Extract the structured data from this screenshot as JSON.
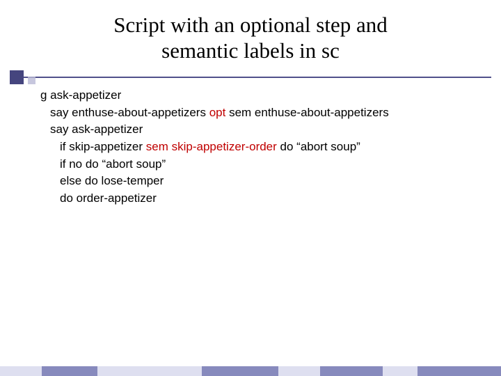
{
  "title_line1": "Script with an optional step and",
  "title_line2": "semantic labels in sc",
  "lines": {
    "l1": "g ask-appetizer",
    "l2a": "say enthuse-about-appetizers ",
    "l2b": "opt",
    "l2c": " sem enthuse-about-appetizers",
    "l3": "say ask-appetizer",
    "l4a": "if skip-appetizer ",
    "l4b": "sem skip-appetizer-order",
    "l4c": " do “abort soup”",
    "l5": "if no do “abort soup”",
    "l6": "else do lose-temper",
    "l7": "do order-appetizer"
  }
}
